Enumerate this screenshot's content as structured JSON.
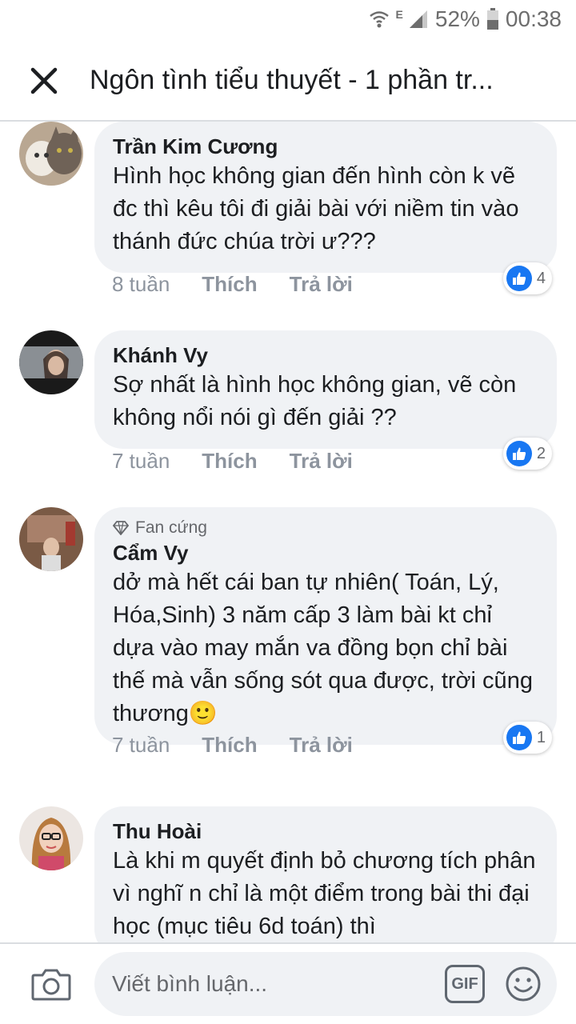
{
  "status_bar": {
    "network_type": "E",
    "battery": "52%",
    "time": "00:38"
  },
  "header": {
    "title": "Ngôn tình tiểu thuyết - 1 phần tr..."
  },
  "comments": [
    {
      "author": "Trần Kim Cương",
      "text": "Hình học không gian đến hình còn k vẽ đc thì kêu tôi đi giải bài với niềm tin vào thánh đức chúa trời ư???",
      "time": "8 tuần",
      "like_label": "Thích",
      "reply_label": "Trả lời",
      "reaction_count": "4"
    },
    {
      "author": "Khánh Vy",
      "text": "Sợ nhất là hình học không gian, vẽ còn không nổi nói gì đến giải ??",
      "time": "7 tuần",
      "like_label": "Thích",
      "reply_label": "Trả lời",
      "reaction_count": "2"
    },
    {
      "badge": "Fan cứng",
      "author": "Cẩm Vy",
      "text": "dở mà hết cái ban tự nhiên( Toán, Lý, Hóa,Sinh) 3 năm cấp 3 làm bài kt chỉ dựa vào may mắn va đồng bọn chỉ bài thế mà vẫn sống sót qua được, trời cũng thương🙂",
      "time": "7 tuần",
      "like_label": "Thích",
      "reply_label": "Trả lời",
      "reaction_count": "1"
    },
    {
      "author": "Thu Hoài",
      "text": "Là khi m quyết định bỏ chương tích phân vì nghĩ n chỉ là một điểm trong bài thi đại học (mục tiêu 6d toán) thì"
    }
  ],
  "composer": {
    "placeholder": "Viết bình luận...",
    "gif_label": "GIF"
  },
  "icons": {
    "close": "close-icon",
    "camera": "camera-icon",
    "emoji": "emoji-icon",
    "like": "like-thumb-icon",
    "wifi": "wifi-icon",
    "signal": "signal-icon",
    "battery": "battery-icon",
    "diamond": "diamond-icon"
  },
  "colors": {
    "like_blue": "#1877f2",
    "bubble_bg": "#f0f2f5",
    "meta_gray": "#8d949e"
  }
}
